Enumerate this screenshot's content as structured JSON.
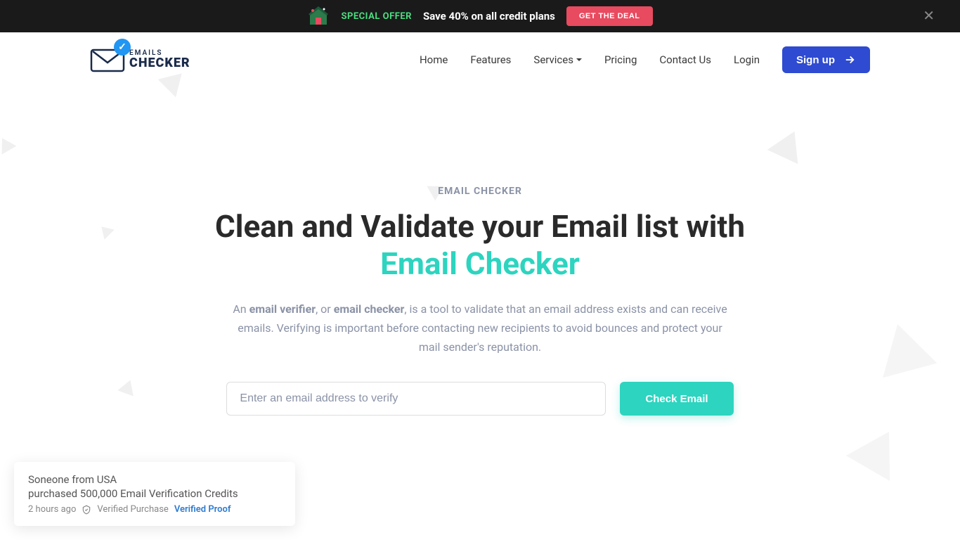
{
  "banner": {
    "special": "SPECIAL OFFER",
    "text": "Save 40% on all credit plans",
    "cta": "GET THE DEAL"
  },
  "logo": {
    "top": "EMAILS",
    "bottom": "CHECKER"
  },
  "nav": {
    "home": "Home",
    "features": "Features",
    "services": "Services",
    "pricing": "Pricing",
    "contact": "Contact Us",
    "login": "Login",
    "signup": "Sign up"
  },
  "hero": {
    "label": "EMAIL CHECKER",
    "title_part1": "Clean and Validate your Email list with ",
    "title_accent": "Email Checker",
    "desc_prefix": "An ",
    "desc_bold1": "email verifier",
    "desc_mid1": ", or ",
    "desc_bold2": "email checker",
    "desc_suffix": ", is a tool to validate that an email address exists and can receive emails. Verifying is important before contacting new recipients to avoid bounces and protect your mail sender's reputation.",
    "placeholder": "Enter an email address to verify",
    "check": "Check Email"
  },
  "notification": {
    "line1": "Soneone from USA",
    "line2": "purchased 500,000 Email Verification Credits",
    "time": "2 hours ago",
    "verified": "Verified Purchase",
    "proof": "Verified Proof"
  }
}
